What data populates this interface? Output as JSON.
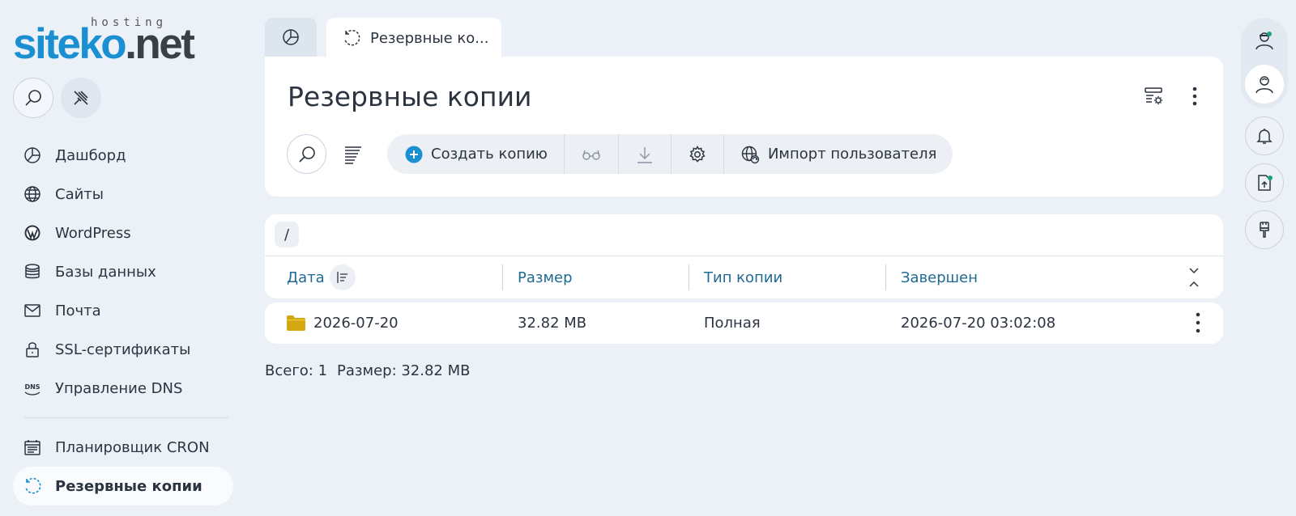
{
  "logo": {
    "brand_part1": "siteko",
    "brand_part2": ".net",
    "tagline": "hosting"
  },
  "sidebar": {
    "items": [
      {
        "label": "Дашборд",
        "icon": "pie-chart-icon"
      },
      {
        "label": "Сайты",
        "icon": "globe-icon"
      },
      {
        "label": "WordPress",
        "icon": "wordpress-icon"
      },
      {
        "label": "Базы данных",
        "icon": "database-icon"
      },
      {
        "label": "Почта",
        "icon": "mail-icon"
      },
      {
        "label": "SSL-сертификаты",
        "icon": "lock-icon"
      },
      {
        "label": "Управление DNS",
        "icon": "dns-icon"
      },
      {
        "label": "Планировщик CRON",
        "icon": "calendar-icon"
      },
      {
        "label": "Резервные копии",
        "icon": "backup-icon",
        "active": true
      }
    ],
    "dns_icon_text": "DNS"
  },
  "tabs": {
    "active_label": "Резервные ко..."
  },
  "page": {
    "title": "Резервные копии"
  },
  "toolbar": {
    "create_label": "Создать копию",
    "import_label": "Импорт пользователя"
  },
  "table": {
    "path": "/",
    "columns": [
      "Дата",
      "Размер",
      "Тип копии",
      "Завершен"
    ],
    "rows": [
      {
        "date": "2026-07-20",
        "size": "32.82 MB",
        "type": "Полная",
        "finished": "2026-07-20 03:02:08"
      }
    ]
  },
  "summary": {
    "total": "Всего: 1",
    "size": "Размер: 32.82 MB"
  },
  "colors": {
    "accent": "#1a8fd1",
    "folder": "#d3a612",
    "header_text": "#1e6a92",
    "background": "#ecf1f8"
  }
}
